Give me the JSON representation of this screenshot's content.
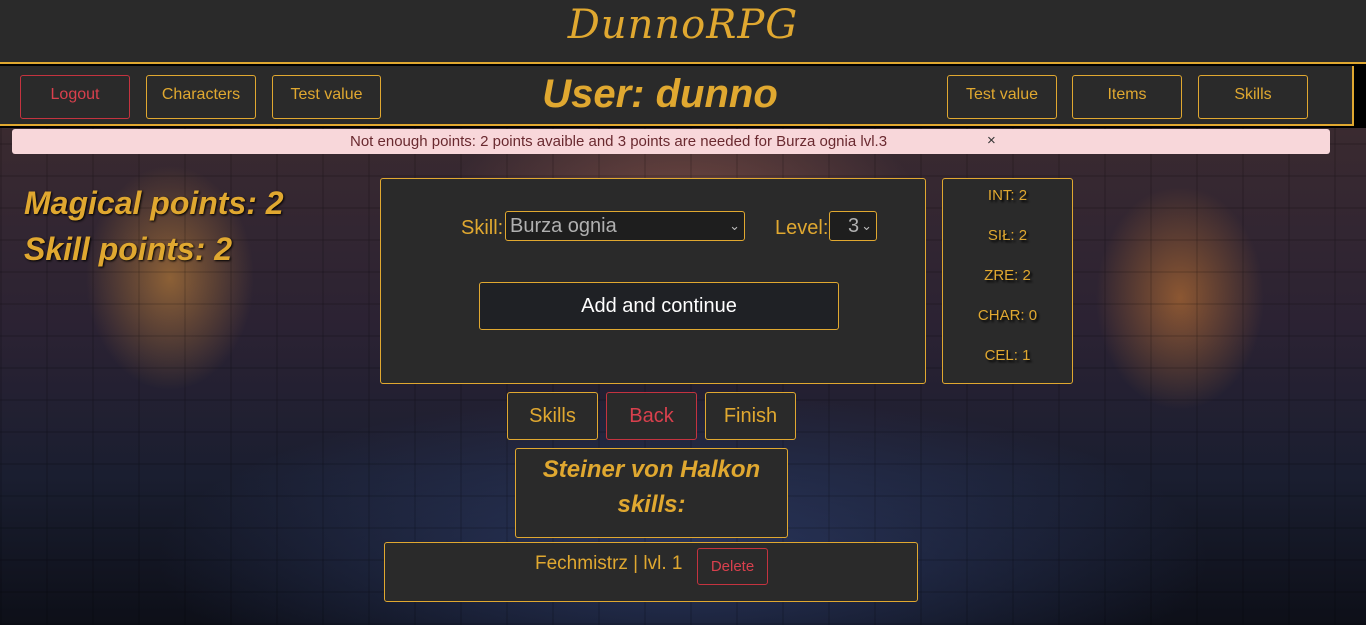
{
  "app": {
    "title": "DunnoRPG"
  },
  "nav": {
    "logout": "Logout",
    "characters": "Characters",
    "test_value_left": "Test value",
    "user_title": "User: dunno",
    "test_value_right": "Test value",
    "items": "Items",
    "skills": "Skills"
  },
  "alert": {
    "message": "Not enough points: 2 points avaible and 3 points are needed for Burza ognia lvl.3",
    "close": "×"
  },
  "points": {
    "magical": "Magical points: 2",
    "skill": "Skill points: 2"
  },
  "skill_form": {
    "skill_label": "Skill:",
    "skill_value": "Burza ognia",
    "level_label": "Level:",
    "level_value": "3",
    "add_button": "Add and continue"
  },
  "stats": [
    "INT: 2",
    "SIŁ: 2",
    "ZRE: 2",
    "CHAR: 0",
    "CEL: 1"
  ],
  "actions": {
    "skills": "Skills",
    "back": "Back",
    "finish": "Finish"
  },
  "character": {
    "heading_line1": "Steiner von Halkon",
    "heading_line2": "skills:"
  },
  "skill_list": [
    {
      "text": "Fechmistrz | lvl. 1",
      "delete": "Delete"
    }
  ],
  "colors": {
    "accent": "#e0a830",
    "danger": "#d9404d",
    "panel": "#2a2a2a",
    "alert_bg": "#f8d7da"
  }
}
